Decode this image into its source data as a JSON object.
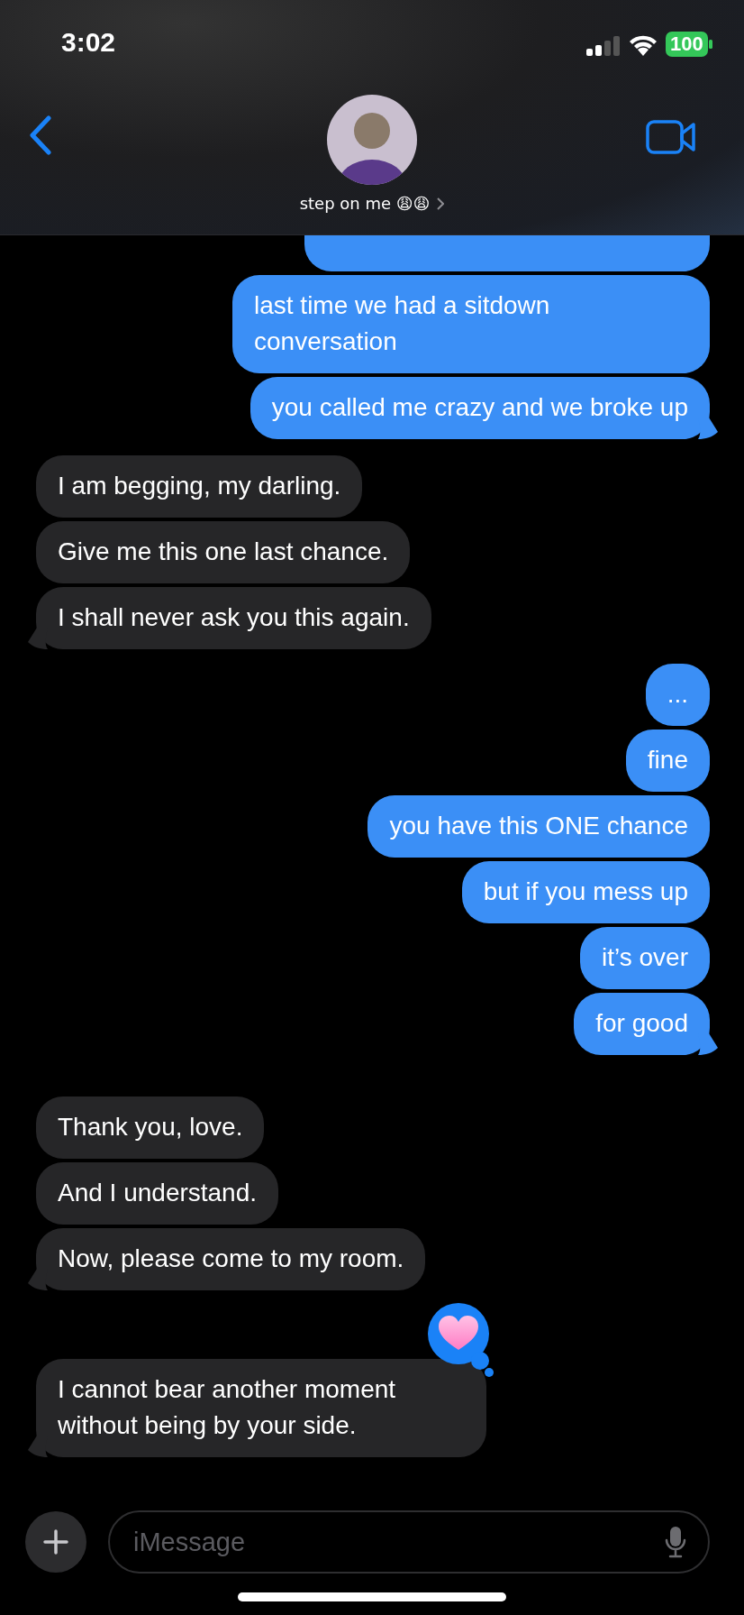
{
  "status_bar": {
    "time": "3:02",
    "battery": "100"
  },
  "header": {
    "contact_name": "step on me 😩😩"
  },
  "groups": [
    {
      "kind": "sent",
      "messages": [
        {
          "kind": "covered"
        },
        {
          "text": "last time we had a sitdown conversation"
        },
        {
          "text": "you called me crazy and we broke up"
        }
      ]
    },
    {
      "kind": "received",
      "messages": [
        {
          "text": "I am begging, my darling."
        },
        {
          "text": "Give me this one last chance."
        },
        {
          "text": "I shall never ask you this again."
        }
      ]
    },
    {
      "kind": "sent",
      "messages": [
        {
          "text": "..."
        },
        {
          "text": "fine"
        },
        {
          "text": "you have this ONE chance"
        },
        {
          "text": "but if you mess up"
        },
        {
          "text": "it’s over"
        },
        {
          "text": "for good"
        }
      ]
    },
    {
      "kind": "received",
      "messages": [
        {
          "text": "Thank you, love."
        },
        {
          "text": "And I understand."
        },
        {
          "text": "Now, please come to my room."
        }
      ]
    },
    {
      "kind": "received",
      "messages": [
        {
          "text": "I cannot bear another moment without being by your side.",
          "reaction": {
            "kind": "heart"
          }
        }
      ]
    }
  ],
  "composer": {
    "placeholder": "iMessage"
  }
}
